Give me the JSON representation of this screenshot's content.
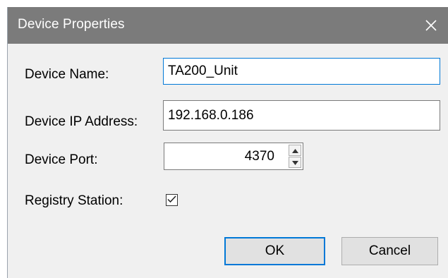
{
  "window": {
    "title": "Device Properties",
    "close_glyph": "close-icon"
  },
  "form": {
    "device_name": {
      "label": "Device Name:",
      "value": "TA200_Unit"
    },
    "device_ip": {
      "label": "Device IP Address:",
      "value": "192.168.0.186"
    },
    "device_port": {
      "label": "Device Port:",
      "value": "4370"
    },
    "registry_station": {
      "label": "Registry Station:",
      "checked": true
    }
  },
  "buttons": {
    "ok_label": "OK",
    "cancel_label": "Cancel"
  },
  "colors": {
    "titlebar": "#7b7b7b",
    "dialog_bg": "#f0f0f0",
    "focus_accent": "#0078d7"
  }
}
